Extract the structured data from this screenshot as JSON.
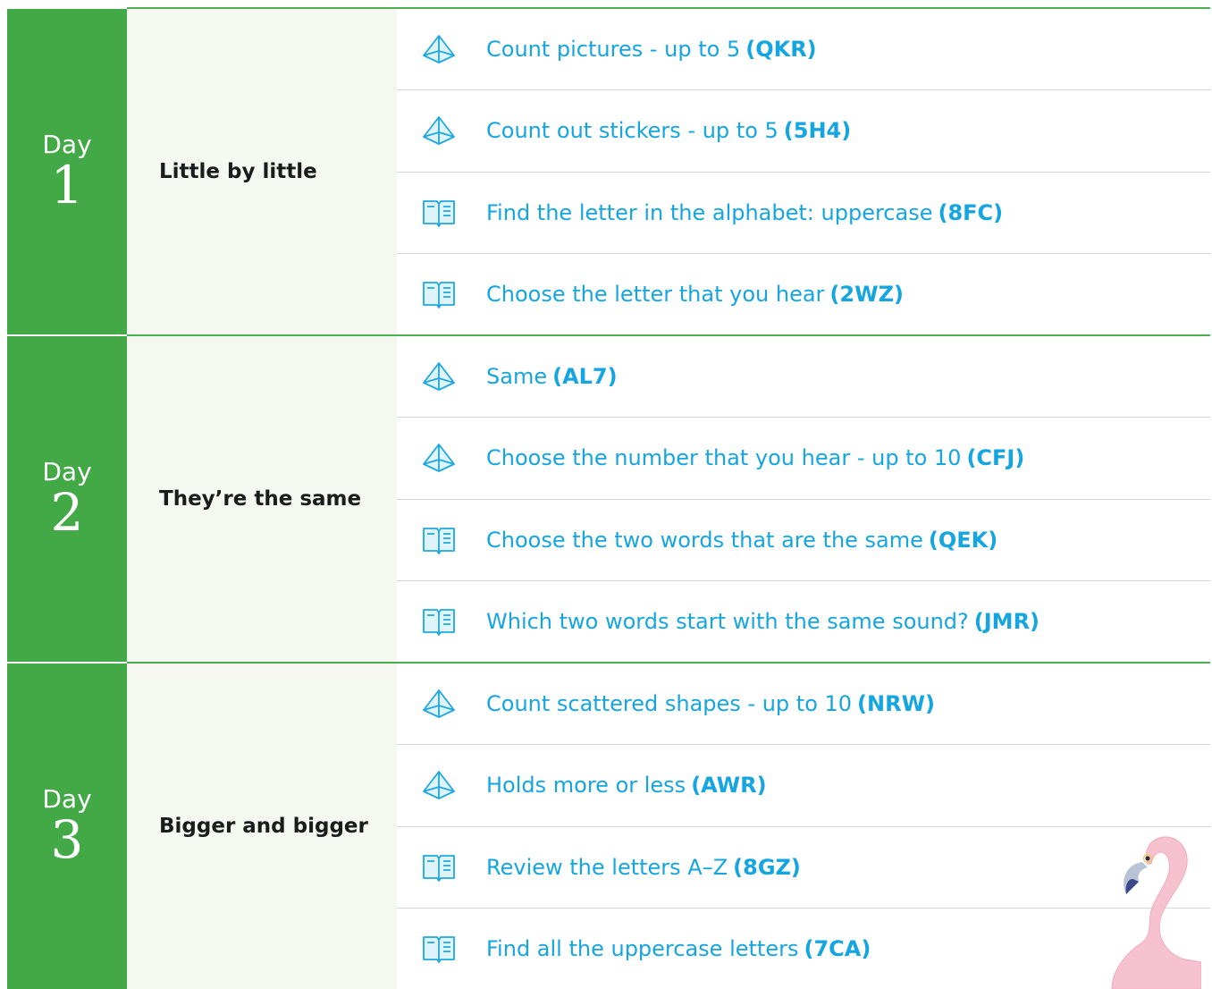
{
  "days": [
    {
      "label": "Day",
      "number": "1",
      "theme": "Little by little",
      "skills": [
        {
          "type": "math",
          "icon": "pyramid-icon",
          "title": "Count pictures - up to 5",
          "code": "(QKR)"
        },
        {
          "type": "math",
          "icon": "pyramid-icon",
          "title": "Count out stickers - up to 5",
          "code": "(5H4)"
        },
        {
          "type": "ela",
          "icon": "book-icon",
          "title": "Find the letter in the alphabet: uppercase",
          "code": "(8FC)"
        },
        {
          "type": "ela",
          "icon": "book-icon",
          "title": "Choose the letter that you hear",
          "code": "(2WZ)"
        }
      ]
    },
    {
      "label": "Day",
      "number": "2",
      "theme": "They’re the same",
      "skills": [
        {
          "type": "math",
          "icon": "pyramid-icon",
          "title": "Same",
          "code": "(AL7)"
        },
        {
          "type": "math",
          "icon": "pyramid-icon",
          "title": "Choose the number that you hear - up to 10",
          "code": "(CFJ)"
        },
        {
          "type": "ela",
          "icon": "book-icon",
          "title": "Choose the two words that are the same",
          "code": "(QEK)"
        },
        {
          "type": "ela",
          "icon": "book-icon",
          "title": "Which two words start with the same sound?",
          "code": "(JMR)"
        }
      ]
    },
    {
      "label": "Day",
      "number": "3",
      "theme": "Bigger and bigger",
      "skills": [
        {
          "type": "math",
          "icon": "pyramid-icon",
          "title": "Count scattered shapes - up to 10",
          "code": "(NRW)"
        },
        {
          "type": "math",
          "icon": "pyramid-icon",
          "title": "Holds more or less",
          "code": "(AWR)"
        },
        {
          "type": "ela",
          "icon": "book-icon",
          "title": "Review the letters A–Z",
          "code": "(8GZ)"
        },
        {
          "type": "ela",
          "icon": "book-icon",
          "title": "Find all the uppercase letters",
          "code": "(7CA)"
        }
      ]
    }
  ],
  "colors": {
    "day_green": "#43a947",
    "rule_green": "#4caf50",
    "theme_bg": "#f4f8f1",
    "link_blue": "#15a5e0"
  }
}
